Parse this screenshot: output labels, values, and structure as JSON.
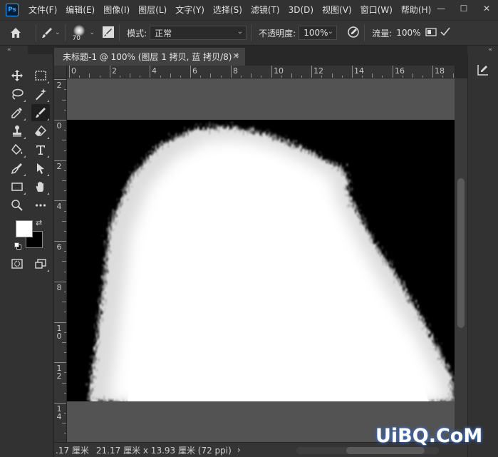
{
  "app": {
    "logo_text": "Ps"
  },
  "menu": {
    "items": [
      "文件(F)",
      "编辑(E)",
      "图像(I)",
      "图层(L)",
      "文字(Y)",
      "选择(S)",
      "滤镜(T)",
      "3D(D)",
      "视图(V)",
      "窗口(W)",
      "帮助(H)"
    ]
  },
  "window_controls": {
    "minimize": "—",
    "restore": "☐",
    "close": "✕"
  },
  "options": {
    "brush_size": "70",
    "mode_label": "模式:",
    "mode_value": "正常",
    "opacity_label": "不透明度:",
    "opacity_value": "100%",
    "flow_label": "流量:",
    "flow_value": "100%"
  },
  "collapse": {
    "left": "«",
    "right": "«"
  },
  "document": {
    "tab_title": "未标题-1 @ 100% (图层 1 拷贝, 蓝 拷贝/8) *",
    "close": "×"
  },
  "ruler": {
    "h_labels": [
      "0",
      "2",
      "4",
      "6",
      "8",
      "10",
      "12",
      "14",
      "16",
      "18"
    ],
    "v_labels": [
      "2",
      "0",
      "2",
      "4",
      "6",
      "8",
      "10",
      "12",
      "14"
    ]
  },
  "status": {
    "zoom_fragment": ".17 厘米",
    "doc_size": "21.17 厘米 x 13.93 厘米 (72 ppi)",
    "arrow": "›"
  },
  "colors": {
    "foreground": "#ffffff",
    "background": "#000000",
    "accent": "#31a8ff"
  },
  "watermark": {
    "text": "UiBQ.CoM"
  }
}
